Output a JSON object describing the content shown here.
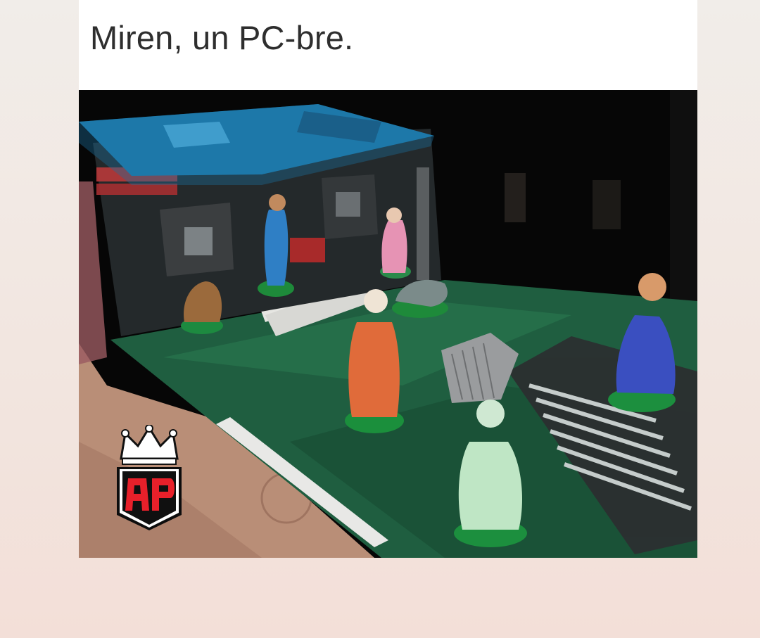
{
  "post": {
    "caption": "Miren, un PC-bre."
  },
  "image": {
    "subject_icon": "motherboard-nativity-scene",
    "watermark_text": "AP"
  },
  "colors": {
    "background": "#f1ede9",
    "card": "#ffffff",
    "caption_text": "#2e2e2e",
    "board_green": "#1f6a46",
    "logo_red": "#e8202a"
  }
}
